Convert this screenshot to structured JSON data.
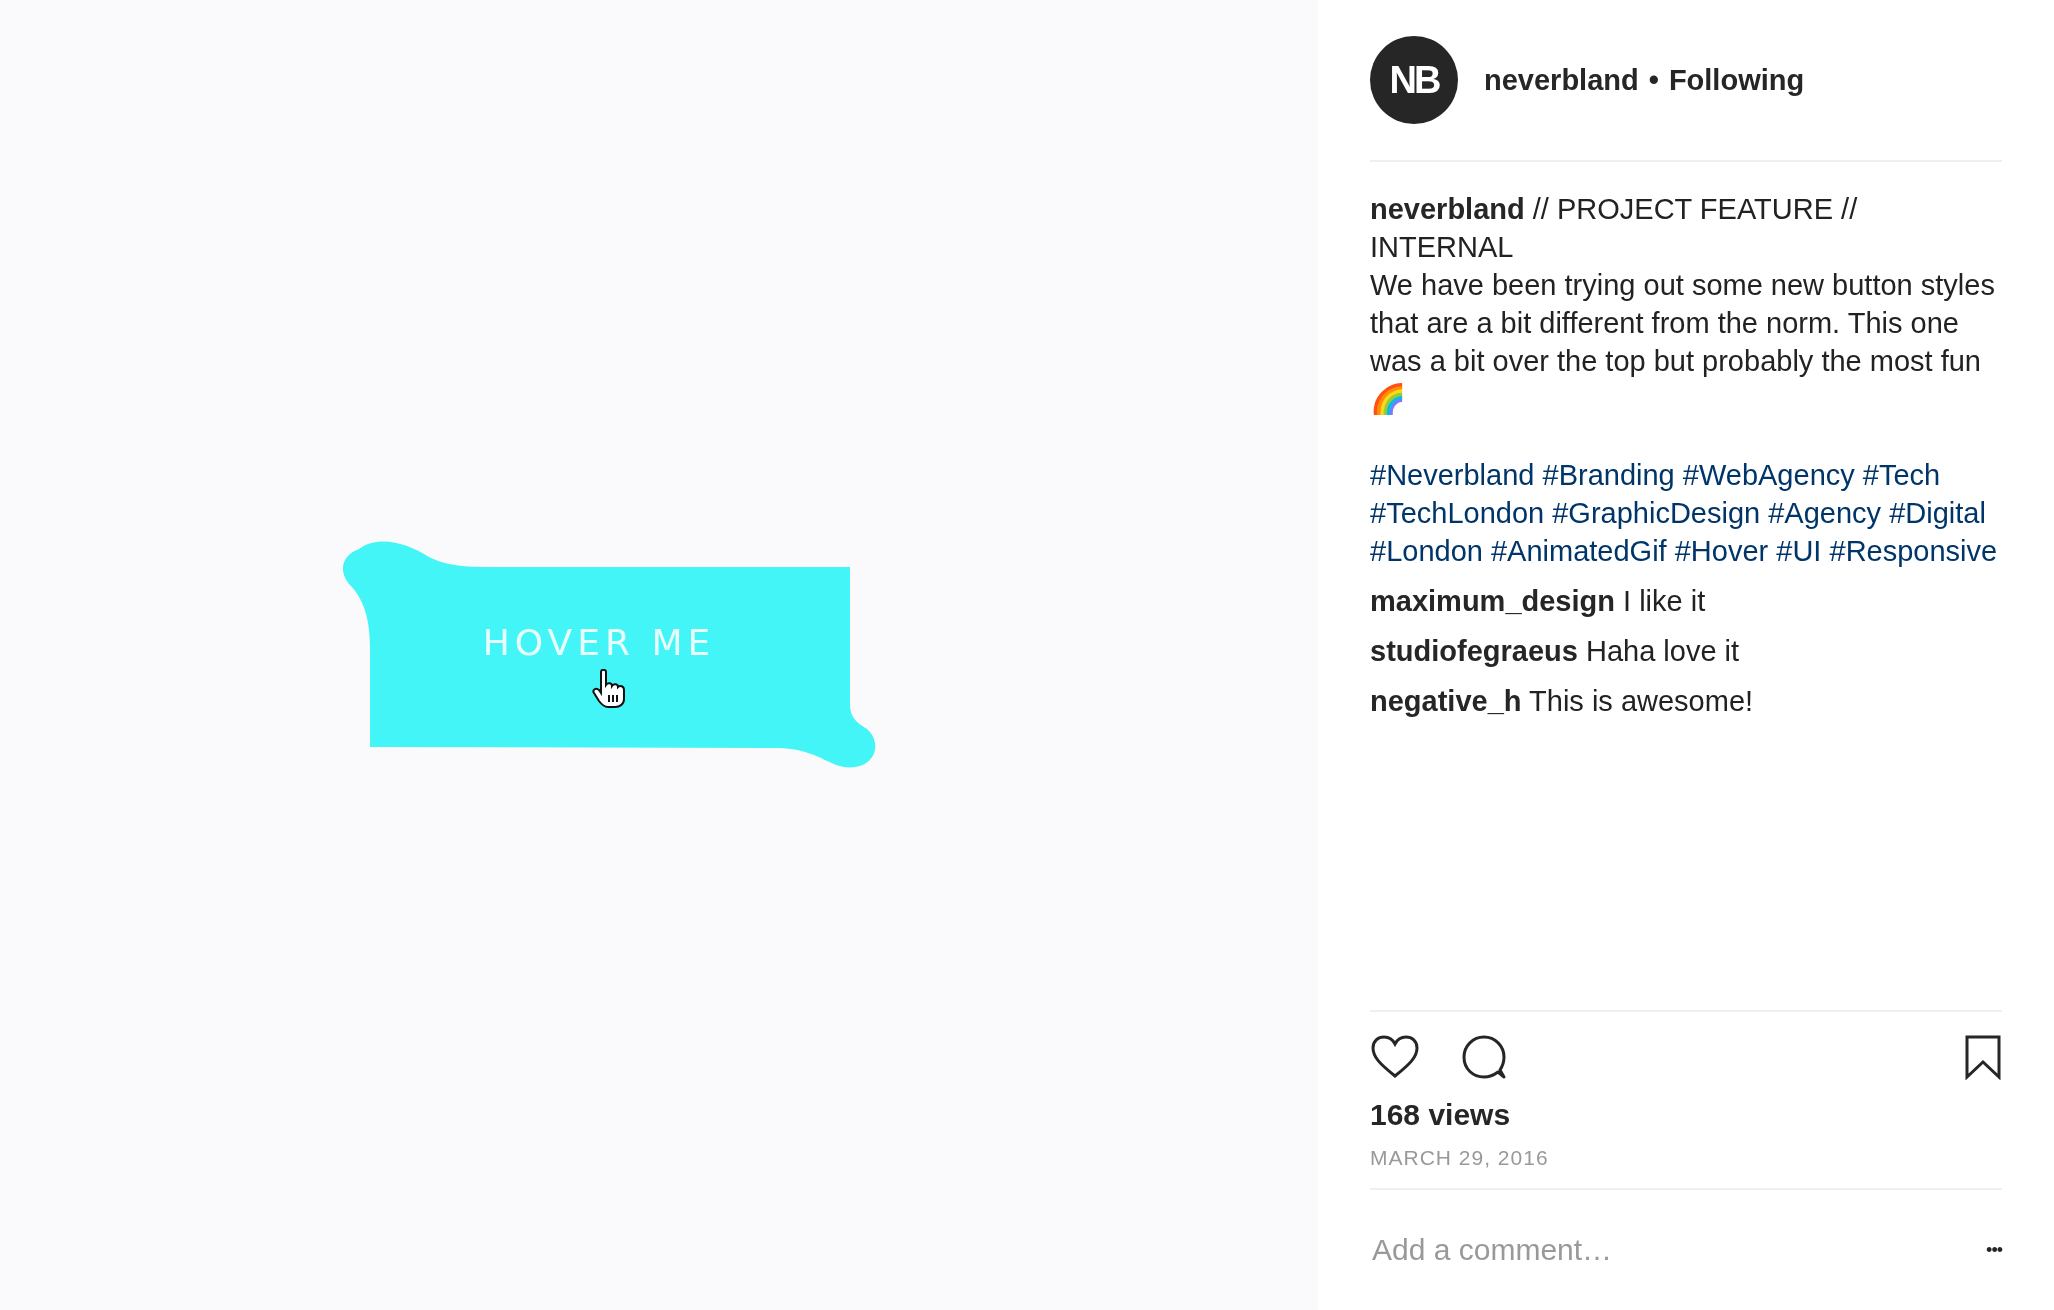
{
  "media": {
    "button_label": "HOVER ME"
  },
  "header": {
    "username": "neverbland",
    "separator": "•",
    "follow_status": "Following",
    "avatar_text": "NB"
  },
  "caption": {
    "username": "neverbland",
    "text": "// PROJECT FEATURE // INTERNAL\nWe have been trying out some new button styles that are a bit different from the norm. This one was a bit over the top but probably the most fun 🌈"
  },
  "hashtags": [
    "#Neverbland",
    "#Branding",
    "#WebAgency",
    "#Tech",
    "#TechLondon",
    "#GraphicDesign",
    "#Agency",
    "#Digital",
    "#London",
    "#AnimatedGif",
    "#Hover",
    "#UI",
    "#Responsive"
  ],
  "comments": [
    {
      "username": "maximum_design",
      "text": "I like it"
    },
    {
      "username": "studiofegraeus",
      "text": "Haha love it"
    },
    {
      "username": "negative_h",
      "text": "This is awesome!"
    }
  ],
  "views": "168 views",
  "date": "MARCH 29, 2016",
  "comment_field": {
    "placeholder": "Add a comment…"
  },
  "more": "•••"
}
